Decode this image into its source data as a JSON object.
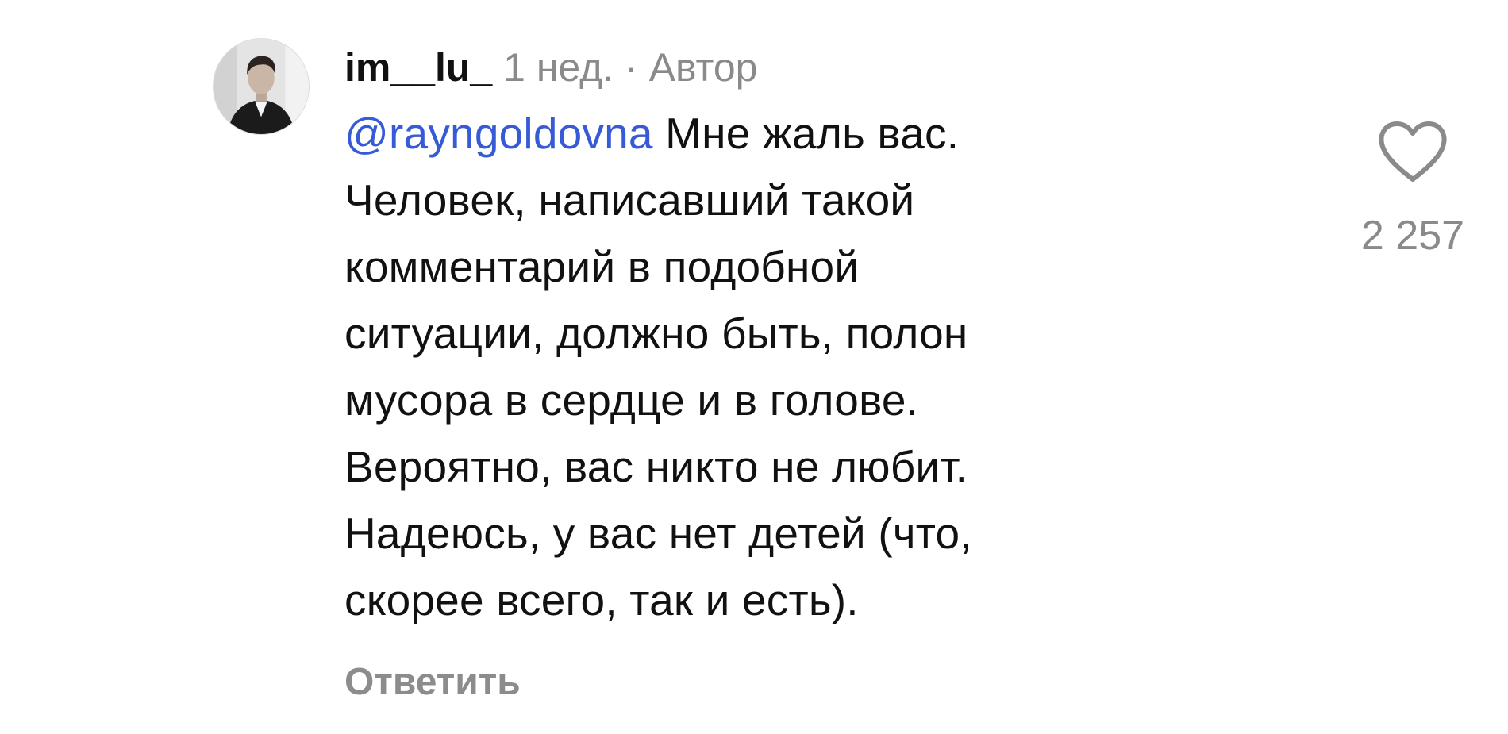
{
  "comment": {
    "username": "im__lu_",
    "timestamp": "1 нед.",
    "separator": "·",
    "author_badge": "Автор",
    "mention": "@rayngoldovna",
    "first_line_rest": " Мне жаль вас.",
    "lines": [
      "Человек, написавший такой",
      "комментарий в подобной",
      "ситуации, должно быть, полон",
      "мусора в сердце и в голове.",
      "Вероятно, вас никто не любит.",
      "Надеюсь, у вас нет детей (что,",
      "скорее всего, так и есть)."
    ],
    "reply_label": "Ответить",
    "like_count": "2 257"
  },
  "icons": {
    "like": "heart-outline-icon",
    "avatar": "user-avatar"
  },
  "colors": {
    "mention": "#375bd6",
    "secondary_text": "#8a8a8a",
    "primary_text": "#111111"
  }
}
